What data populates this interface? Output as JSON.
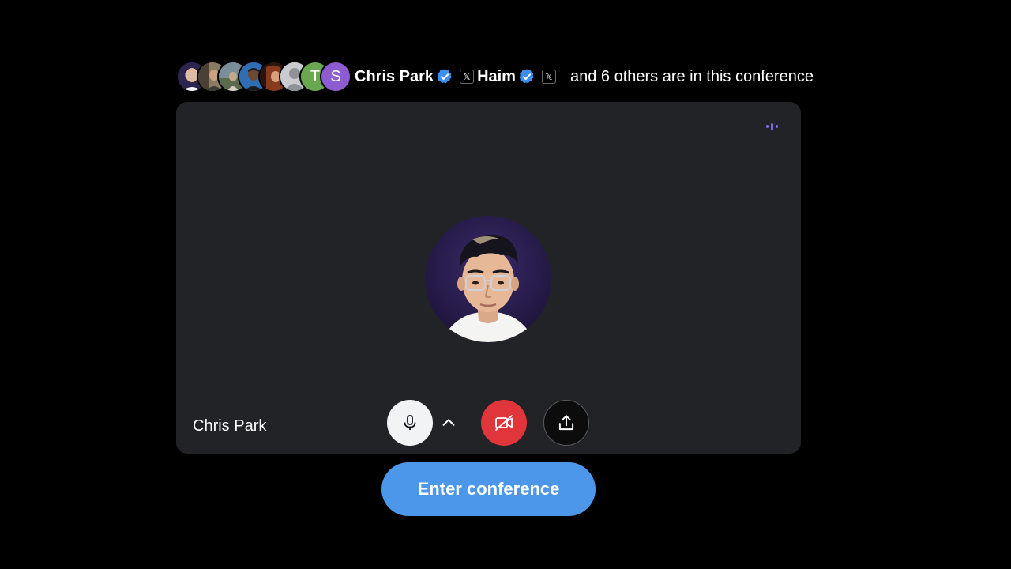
{
  "header": {
    "participants": [
      {
        "name": "Chris Park",
        "initial": "",
        "icon": "portrait-photo-icon"
      },
      {
        "name": "",
        "initial": "",
        "icon": "portrait-photo-icon"
      },
      {
        "name": "",
        "initial": "",
        "icon": "portrait-photo-icon"
      },
      {
        "name": "",
        "initial": "",
        "icon": "portrait-photo-icon"
      },
      {
        "name": "",
        "initial": "",
        "icon": "portrait-photo-icon"
      },
      {
        "name": "",
        "initial": "",
        "icon": "default-user-icon"
      },
      {
        "name": "",
        "initial": "T",
        "icon": ""
      },
      {
        "name": "",
        "initial": "S",
        "icon": ""
      }
    ],
    "first_name": "Chris Park",
    "second_name": "Haim",
    "x_badge": "𝕏",
    "suffix": "and 6 others are in this conference"
  },
  "stage": {
    "speaker_name": "Chris Park",
    "speaking_indicator_icon": "audio-level-icon"
  },
  "controls": {
    "mic_icon": "microphone-icon",
    "mic_options_icon": "chevron-up-icon",
    "camera_icon": "camera-off-icon",
    "share_icon": "share-upload-icon"
  },
  "actions": {
    "enter_label": "Enter conference"
  },
  "colors": {
    "background": "#000000",
    "card": "#222326",
    "verified": "#3d8ef0",
    "camera_off": "#e0353a",
    "primary_button": "#4c97ea",
    "speaking": "#7a6ae8",
    "avatar_t": "#6aa84f",
    "avatar_s": "#8e5cd1"
  }
}
